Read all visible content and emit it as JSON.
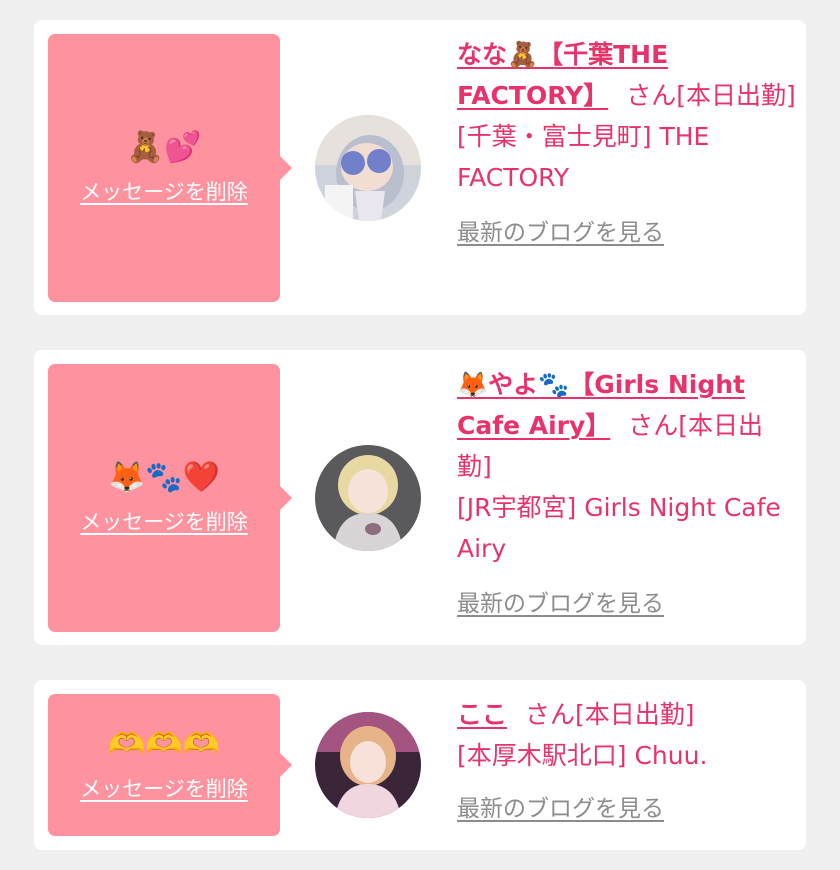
{
  "messages": [
    {
      "emoji": "🧸💕",
      "delete_label": "メッセージを削除",
      "name": "なな🧸【千葉THE FACTORY】",
      "san": "さん[本日出勤]",
      "shop": "[千葉・富士見町] THE FACTORY",
      "blog_label": "最新のブログを見る"
    },
    {
      "emoji": "🦊🐾❤️",
      "delete_label": "メッセージを削除",
      "name": "🦊やよ🐾【Girls Night Cafe Airy】",
      "san": "さん[本日出勤]",
      "shop": "[JR宇都宮] Girls Night Cafe Airy",
      "blog_label": "最新のブログを見る"
    },
    {
      "emoji": "🫶🫶🫶",
      "delete_label": "メッセージを削除",
      "name": "ここ",
      "san": "さん[本日出勤]",
      "shop": "[本厚木駅北口] Chuu.",
      "blog_label": "最新のブログを見る"
    }
  ],
  "colors": {
    "accent": "#e8336a",
    "bubble": "#ff929f",
    "muted": "#8c8c8c",
    "background": "#f0f0f0"
  }
}
